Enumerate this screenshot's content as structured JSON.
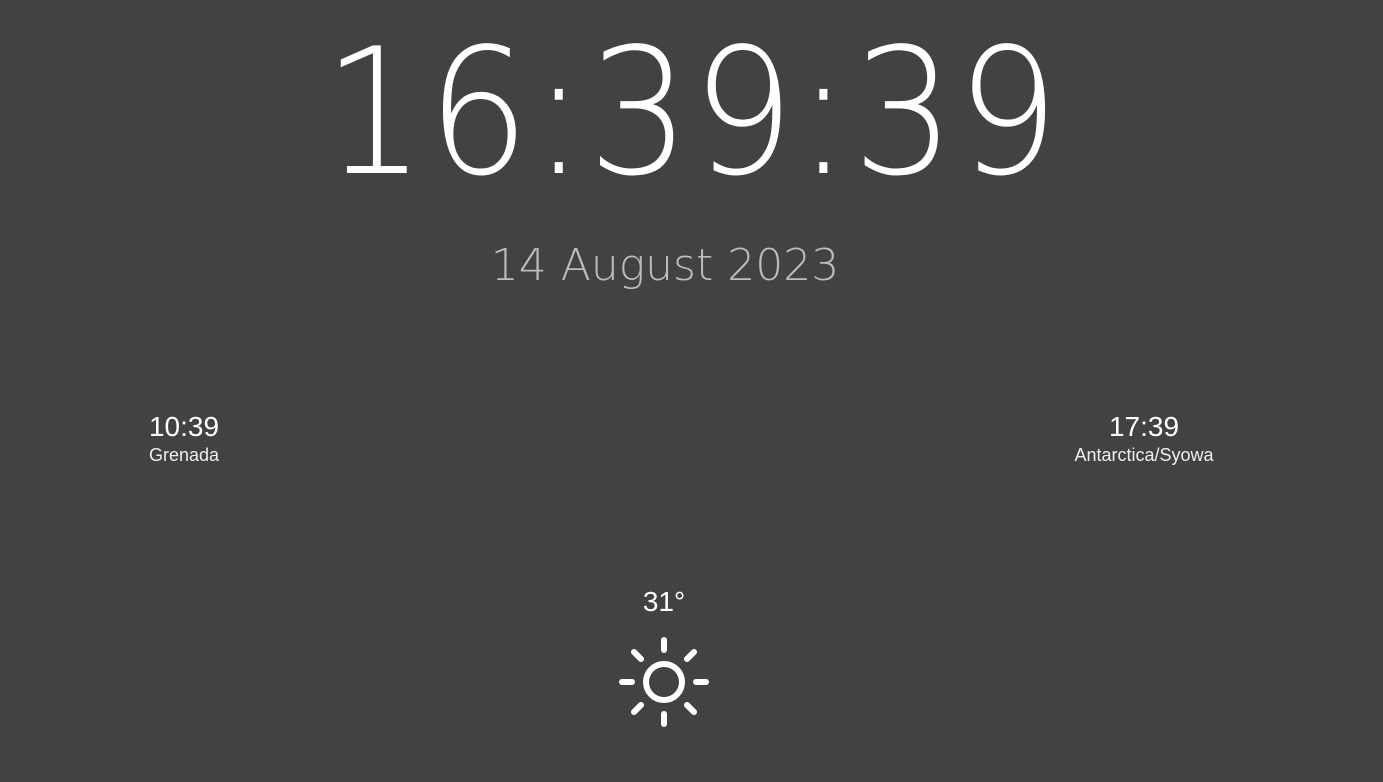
{
  "clock": {
    "time": "16:39:39",
    "date": "14 August 2023"
  },
  "world_clocks": [
    {
      "time": "10:39",
      "zone": "Grenada"
    },
    {
      "time": "17:39",
      "zone": "Antarctica/Syowa"
    }
  ],
  "weather": {
    "temperature": "31°",
    "icon": "sun-icon"
  },
  "colors": {
    "background": "#424242",
    "primary_text": "#ffffff",
    "date_text": "#bdbdbd"
  }
}
